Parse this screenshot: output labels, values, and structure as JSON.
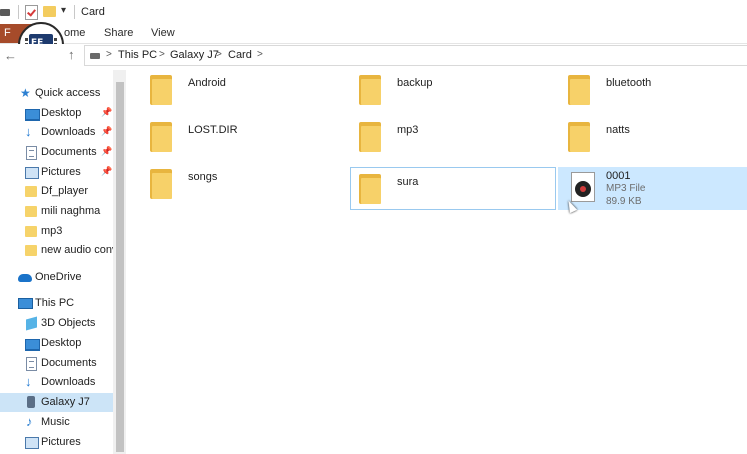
{
  "window": {
    "title": "Card"
  },
  "ribbon": {
    "file_label": "F",
    "tabs": [
      "ome",
      "Share",
      "View"
    ]
  },
  "address": {
    "crumbs": [
      "This PC",
      "Galaxy J7",
      "Card"
    ],
    "separator": ">"
  },
  "logo_text": "FE",
  "sidebar": {
    "quick_access": "Quick access",
    "quick_items": [
      {
        "label": "Desktop",
        "icon": "desktop-icon",
        "pinned": true
      },
      {
        "label": "Downloads",
        "icon": "downloads-icon",
        "pinned": true
      },
      {
        "label": "Documents",
        "icon": "documents-icon",
        "pinned": true
      },
      {
        "label": "Pictures",
        "icon": "pictures-icon",
        "pinned": true
      },
      {
        "label": "Df_player",
        "icon": "folder-icon"
      },
      {
        "label": "mili naghma",
        "icon": "folder-icon"
      },
      {
        "label": "mp3",
        "icon": "folder-icon"
      },
      {
        "label": "new audio conv",
        "icon": "folder-icon"
      }
    ],
    "onedrive": "OneDrive",
    "this_pc": "This PC",
    "pc_items": [
      {
        "label": "3D Objects",
        "icon": "3d-objects-icon"
      },
      {
        "label": "Desktop",
        "icon": "desktop-icon"
      },
      {
        "label": "Documents",
        "icon": "documents-icon"
      },
      {
        "label": "Downloads",
        "icon": "downloads-icon"
      },
      {
        "label": "Galaxy J7",
        "icon": "phone-icon",
        "selected": true
      },
      {
        "label": "Music",
        "icon": "music-icon"
      },
      {
        "label": "Pictures",
        "icon": "pictures-icon"
      }
    ]
  },
  "files": [
    {
      "name": "Android",
      "type": "folder"
    },
    {
      "name": "backup",
      "type": "folder"
    },
    {
      "name": "bluetooth",
      "type": "folder"
    },
    {
      "name": "LOST.DIR",
      "type": "folder"
    },
    {
      "name": "mp3",
      "type": "folder"
    },
    {
      "name": "natts",
      "type": "folder"
    },
    {
      "name": "songs",
      "type": "folder"
    },
    {
      "name": "sura",
      "type": "folder",
      "state": "hovered"
    },
    {
      "name": "0001",
      "type": "mp3",
      "kind": "MP3 File",
      "size": "89.9 KB",
      "state": "selected"
    }
  ],
  "colors": {
    "file_tab": "#a64b2a",
    "selection": "#cce8ff",
    "folder": "#f7d169"
  }
}
